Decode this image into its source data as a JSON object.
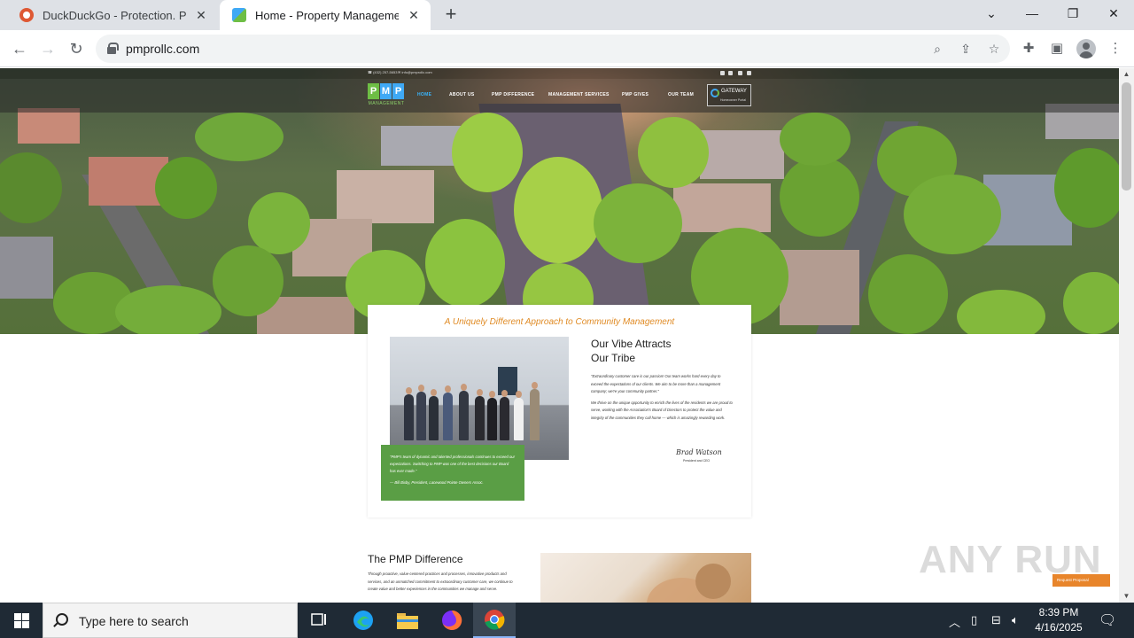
{
  "browser": {
    "tabs": [
      {
        "title": "DuckDuckGo - Protection. Privacy",
        "favicon": "duckduckgo-icon",
        "active": false
      },
      {
        "title": "Home - Property Management I",
        "favicon": "pmp-favicon",
        "active": true
      }
    ],
    "url": "pmprollc.com"
  },
  "site": {
    "topbar": {
      "phone": "☎ (432) 257-5653",
      "email": "✉ info@pmprollc.com"
    },
    "logo": {
      "letters": [
        "P",
        "M",
        "P"
      ],
      "sub": "MANAGEMENT",
      "colors": [
        "#6ebe45",
        "#3fa9f5",
        "#3fa9f5"
      ]
    },
    "nav": [
      {
        "label": "HOME",
        "active": true
      },
      {
        "label": "ABOUT US",
        "active": false
      },
      {
        "label": "PMP DIFFERENCE",
        "active": false
      },
      {
        "label": "MANAGEMENT SERVICES",
        "active": false
      },
      {
        "label": "PMP GIVES",
        "active": false
      },
      {
        "label": "OUR TEAM",
        "active": false
      }
    ],
    "gateway": {
      "title": "GATEWAY",
      "sub": "Homeowner Portal"
    },
    "tagline": "A Uniquely Different Approach to Community Management",
    "vibe": {
      "title_line1": "Our Vibe Attracts",
      "title_line2": "Our Tribe",
      "para1": "\"Extraordinary customer care is our passion! Our team works hard every day to exceed the expectations of our clients. We aim to be more than a management company; we're your community partner.\"",
      "para2": "We thrive on the unique opportunity to enrich the lives of the residents we are proud to serve, working with the Association's Board of Directors to protect the value and integrity of the communities they call home — which is amazingly rewarding work.",
      "signature": "Brad Watson",
      "sig_title": "President and CEO"
    },
    "quote": {
      "text": "\"PMP's team of dynamic and talented professionals continues to exceed our expectations. Switching to PMP was one of the best decisions our Board has ever made.\"",
      "author": "— Bill Bixby, President, Lacewood Pointe Owners Assoc."
    },
    "difference": {
      "title": "The PMP Difference",
      "body": "Through proactive, value-centered practices and processes, innovative products and services, and an unmatched commitment to extraordinary customer care, we continue to create value and better experiences in the communities we manage and serve."
    },
    "watermark": "ANY RUN",
    "request_button": "Request Proposal"
  },
  "taskbar": {
    "search_placeholder": "Type here to search",
    "time": "8:39 PM",
    "date": "4/16/2025"
  },
  "colors": {
    "accent_orange": "#e08b25",
    "quote_green": "#5a9e45",
    "nav_active": "#38b6ff"
  }
}
